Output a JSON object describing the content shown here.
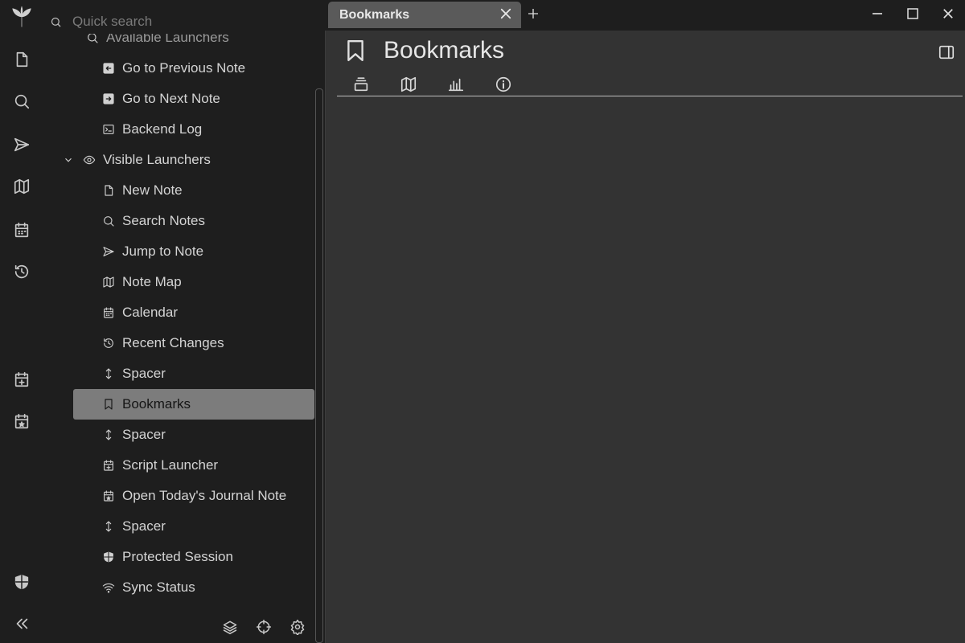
{
  "search": {
    "placeholder": "Quick search"
  },
  "tree": {
    "cut_header": "Available Launchers",
    "items": [
      {
        "label": "Go to Previous Note",
        "icon": "arrow-left-box-icon"
      },
      {
        "label": "Go to Next Note",
        "icon": "arrow-right-box-icon"
      },
      {
        "label": "Backend Log",
        "icon": "terminal-icon"
      },
      {
        "label": "Visible Launchers",
        "icon": "eye-icon",
        "folder": true
      },
      {
        "label": "New Note",
        "icon": "file-icon"
      },
      {
        "label": "Search Notes",
        "icon": "search-icon"
      },
      {
        "label": "Jump to Note",
        "icon": "send-icon"
      },
      {
        "label": "Note Map",
        "icon": "map-icon"
      },
      {
        "label": "Calendar",
        "icon": "calendar-icon"
      },
      {
        "label": "Recent Changes",
        "icon": "history-icon"
      },
      {
        "label": "Spacer",
        "icon": "vertical-arrows-icon"
      },
      {
        "label": "Bookmarks",
        "icon": "bookmark-icon",
        "active": true
      },
      {
        "label": "Spacer",
        "icon": "vertical-arrows-icon"
      },
      {
        "label": "Script Launcher",
        "icon": "calendar-plus-icon"
      },
      {
        "label": "Open Today's Journal Note",
        "icon": "calendar-star-icon"
      },
      {
        "label": "Spacer",
        "icon": "vertical-arrows-icon"
      },
      {
        "label": "Protected Session",
        "icon": "shield-icon"
      },
      {
        "label": "Sync Status",
        "icon": "wifi-icon"
      }
    ]
  },
  "tab": {
    "title": "Bookmarks"
  },
  "note": {
    "title": "Bookmarks"
  }
}
